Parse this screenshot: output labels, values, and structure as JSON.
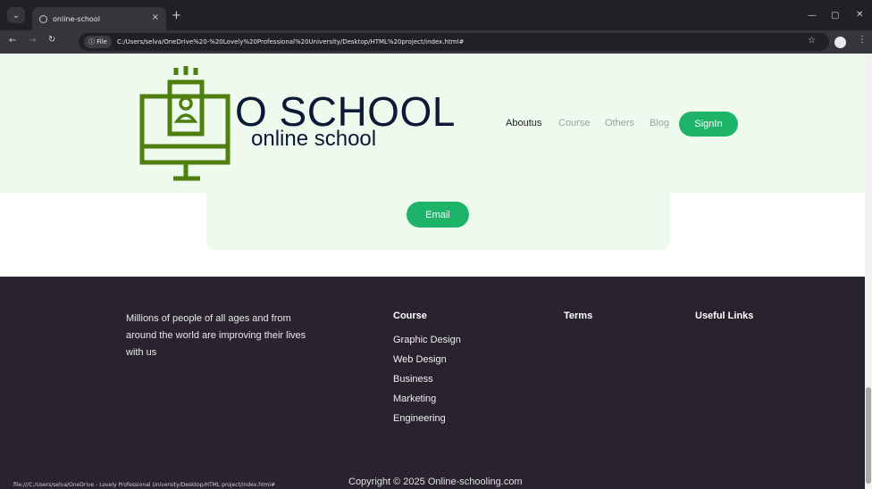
{
  "browser": {
    "tab_title": "online-school",
    "new_tab": "+",
    "close_tab": "×",
    "url_chip": "File",
    "url": "C:/Users/selva/OneDrive%20-%20Lovely%20Professional%20University/Desktop/HTML%20project/index.html#",
    "status_url": "file:///C:/Users/selva/OneDrive - Lovely Professional University/Desktop/HTML project/index.html#"
  },
  "header": {
    "brand_name": "O SCHOOL",
    "brand_sub": "online school",
    "nav": [
      "Aboutus",
      "Course",
      "Others",
      "Blog"
    ],
    "signin": "SignIn"
  },
  "hero": {
    "email_button": "Email"
  },
  "footer": {
    "about": "Millions of people of all ages and from around the world are improving their lives with us",
    "course_title": "Course",
    "course_links": [
      "Graphic Design",
      "Web Design",
      "Business",
      "Marketing",
      "Engineering"
    ],
    "terms_title": "Terms",
    "useful_title": "Useful Links",
    "copyright": "Copyright © 2025 Online-schooling.com"
  },
  "colors": {
    "accent": "#1db46a",
    "hero_bg": "#effaee",
    "footer_bg": "#28232f",
    "logo_green": "#4f7f0f",
    "brand_text": "#0c1937"
  },
  "icons": [
    "menu-chevron-icon",
    "globe-icon",
    "back-icon",
    "forward-icon",
    "reload-icon",
    "info-icon",
    "star-icon",
    "profile-icon",
    "more-icon",
    "minimize-icon",
    "restore-icon",
    "close-icon",
    "school-logo-icon"
  ]
}
